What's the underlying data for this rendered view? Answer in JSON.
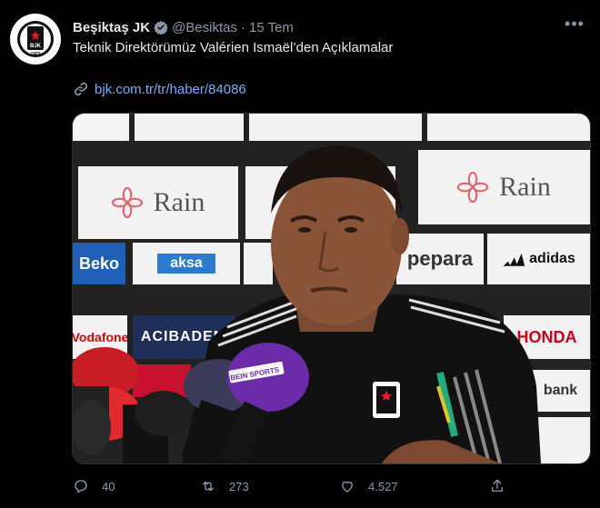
{
  "account": {
    "display_name": "Beşiktaş JK",
    "handle": "@Besiktas",
    "separator": "·",
    "timestamp": "15 Tem",
    "avatar_text": "BJK",
    "avatar_year": "1903"
  },
  "tweet": {
    "text": "Teknik Direktörümüz Valérien Ismaël’den Açıklamalar",
    "link": "bjk.com.tr/tr/haber/84086"
  },
  "media": {
    "sponsors": [
      "Rain",
      "Rain",
      "aksa",
      "ACIBADEM",
      "HONDA",
      "bank",
      "adidas",
      "pepara",
      "Vodafone",
      "Beko"
    ],
    "jersey_crest": "BJK",
    "jersey_brand": "adidas",
    "mic_label": "BEIN SPORTS"
  },
  "actions": {
    "reply_count": "40",
    "retweet_count": "273",
    "like_count": "4.527"
  },
  "colors": {
    "background": "#000000",
    "text": "#e7e9ea",
    "muted": "#8b98a5",
    "link": "#6eb0ff",
    "verified": "#1d9bf0"
  },
  "icons": [
    "verified-badge-icon",
    "more-icon",
    "link-icon",
    "reply-icon",
    "retweet-icon",
    "like-icon",
    "share-icon"
  ]
}
